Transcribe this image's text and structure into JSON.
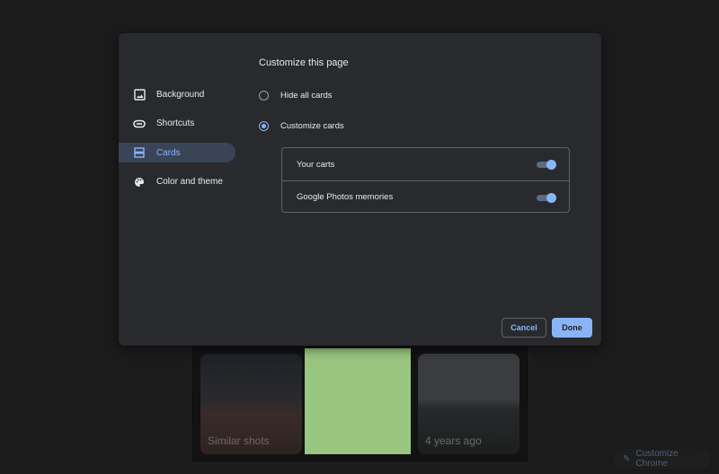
{
  "dialog": {
    "title": "Customize this page",
    "nav": [
      {
        "label": "Background",
        "icon": "background-icon"
      },
      {
        "label": "Shortcuts",
        "icon": "link-icon"
      },
      {
        "label": "Cards",
        "icon": "cards-icon",
        "selected": true
      },
      {
        "label": "Color and theme",
        "icon": "palette-icon"
      }
    ],
    "options": {
      "hide_all": "Hide all cards",
      "customize": "Customize cards",
      "selected": "customize"
    },
    "cards": [
      {
        "label": "Your carts",
        "enabled": true
      },
      {
        "label": "Google Photos memories",
        "enabled": true
      }
    ],
    "cancel_label": "Cancel",
    "done_label": "Done"
  },
  "background": {
    "photos": [
      {
        "caption": "Similar shots"
      },
      {
        "caption": ""
      },
      {
        "caption": "4 years ago"
      }
    ],
    "customize_chrome_label": "Customize Chrome",
    "accent": "#8ab4f8"
  }
}
